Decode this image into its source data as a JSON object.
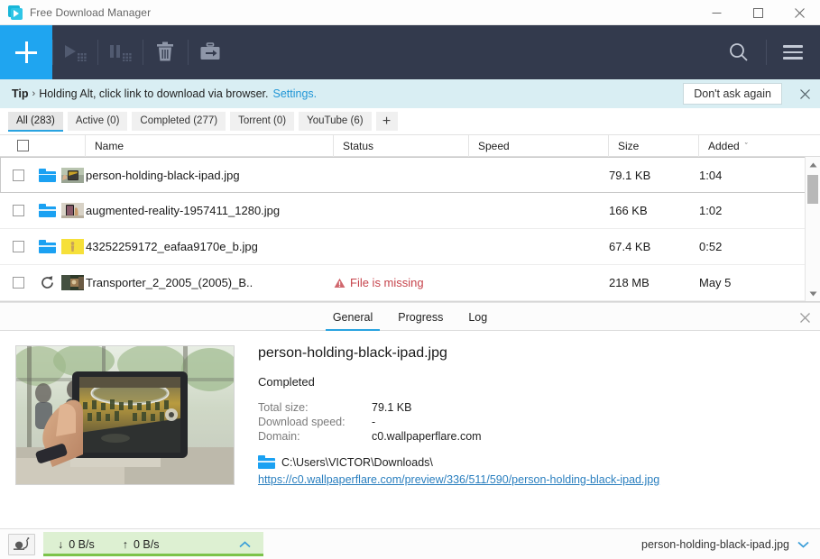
{
  "window": {
    "title": "Free Download Manager",
    "logo_icon": "fdm-logo-icon",
    "minimize_icon": "minimize-icon",
    "maximize_icon": "maximize-icon",
    "close_icon": "close-icon"
  },
  "toolbar": {
    "add_label": "+",
    "add_icon": "plus-icon",
    "buttons": [
      {
        "name": "start-downloads-button",
        "icon": "play-icon",
        "enabled": false
      },
      {
        "name": "pause-downloads-button",
        "icon": "pause-icon",
        "enabled": false
      },
      {
        "name": "delete-button",
        "icon": "trash-icon",
        "enabled": true
      },
      {
        "name": "move-button",
        "icon": "archive-arrow-icon",
        "enabled": true
      }
    ],
    "search_icon": "search-icon",
    "menu_icon": "hamburger-menu-icon"
  },
  "tip": {
    "label": "Tip",
    "chevron": "›",
    "text": "Holding Alt, click link to download via browser.",
    "link": "Settings.",
    "dont_ask_label": "Don't ask again",
    "close_icon": "close-icon"
  },
  "filters": {
    "tabs": [
      {
        "label": "All (283)",
        "active": true
      },
      {
        "label": "Active (0)",
        "active": false
      },
      {
        "label": "Completed (277)",
        "active": false
      },
      {
        "label": "Torrent (0)",
        "active": false
      },
      {
        "label": "YouTube (6)",
        "active": false
      }
    ],
    "add_label": "+"
  },
  "table": {
    "columns": [
      "",
      "Name",
      "Status",
      "Speed",
      "Size",
      "Added"
    ],
    "sort_column": "Added",
    "sort_caret": "ˇ",
    "rows": [
      {
        "name": "person-holding-black-ipad.jpg",
        "status": "",
        "speed": "",
        "size": "79.1 KB",
        "added": "1:04",
        "icon": "folder-icon",
        "selected": true
      },
      {
        "name": "augmented-reality-1957411_1280.jpg",
        "status": "",
        "speed": "",
        "size": "166 KB",
        "added": "1:02",
        "icon": "folder-icon",
        "selected": false
      },
      {
        "name": "43252259172_eafaa9170e_b.jpg",
        "status": "",
        "speed": "",
        "size": "67.4 KB",
        "added": "0:52",
        "icon": "folder-icon",
        "selected": false
      },
      {
        "name": "Transporter_2_2005_(2005)_B..",
        "status": "File is missing",
        "speed": "",
        "size": "218 MB",
        "added": "May 5",
        "icon": "retry-icon",
        "selected": false
      }
    ]
  },
  "details": {
    "tabs": [
      {
        "label": "General",
        "active": true
      },
      {
        "label": "Progress",
        "active": false
      },
      {
        "label": "Log",
        "active": false
      }
    ],
    "close_icon": "close-icon",
    "preview_alt": "person-holding-black-ipad-preview",
    "title": "person-holding-black-ipad.jpg",
    "status": "Completed",
    "fields": [
      {
        "key": "Total size:",
        "value": "79.1 KB"
      },
      {
        "key": "Download speed:",
        "value": "-"
      },
      {
        "key": "Domain:",
        "value": "c0.wallpaperflare.com"
      }
    ],
    "folder_icon": "folder-icon",
    "path": "C:\\Users\\VICTOR\\Downloads\\",
    "url": "https://c0.wallpaperflare.com/preview/336/511/590/person-holding-black-ipad.jpg"
  },
  "statusbar": {
    "speed_limit_icon": "snail-icon",
    "download_icon": "↓",
    "download_speed": "0 B/s",
    "upload_icon": "↑",
    "upload_speed": "0 B/s",
    "expand_icon": "chevron-up-icon",
    "current_file": "person-holding-black-ipad.jpg",
    "current_file_chevron": "chevron-down-icon"
  },
  "colors": {
    "accent": "#1fa5f0",
    "toolbar_bg": "#333a4d",
    "tip_bg": "#d9eef3",
    "error": "#c6434b",
    "speed_bg": "#ddf0d2",
    "speed_bar": "#7cc34a",
    "link": "#2a7fbf"
  }
}
